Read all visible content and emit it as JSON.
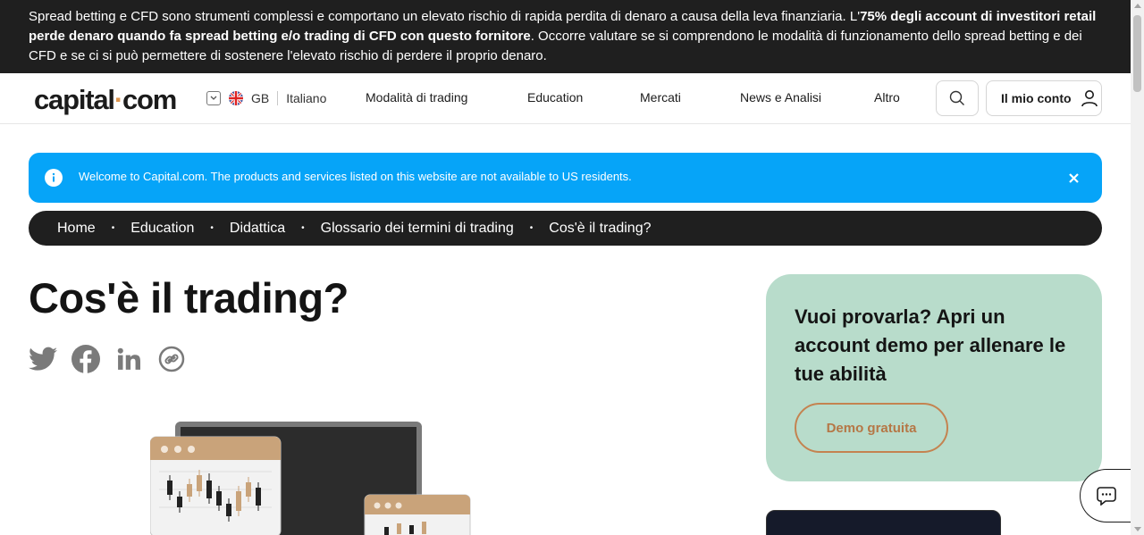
{
  "risk_warning": {
    "part1": "Spread betting e CFD sono strumenti complessi e comportano un elevato rischio di rapida perdita di denaro a causa della leva finanziaria. L'",
    "bold": "75% degli account di investitori retail perde denaro quando fa spread betting e/o trading di CFD con questo fornitore",
    "part2": ". Occorre valutare se si comprendono le modalità di funzionamento dello spread betting e dei CFD e se ci si può permettere di sostenere l'elevato rischio di perdere il proprio denaro."
  },
  "header": {
    "logo_left": "capital",
    "logo_dot": "·",
    "logo_right": "com",
    "region": "GB",
    "language": "Italiano",
    "nav": [
      "Modalità di trading",
      "Education",
      "Mercati",
      "News e Analisi",
      "Altro"
    ],
    "account_label": "Il mio conto"
  },
  "notice": {
    "message": "Welcome to Capital.com. The products and services listed on this website are not available to US residents."
  },
  "breadcrumb": [
    "Home",
    "Education",
    "Didattica",
    "Glossario dei termini di trading",
    "Cos'è il trading?"
  ],
  "breadcrumb_separator": "•",
  "page_title": "Cos'è il trading?",
  "socials": [
    "twitter-icon",
    "facebook-icon",
    "linkedin-icon",
    "copy-link-icon"
  ],
  "promo": {
    "heading": "Vuoi provarla? Apri un account demo per allenare le tue abilità",
    "button": "Demo gratuita"
  },
  "colors": {
    "accent": "#dd9650",
    "notice_bg": "#06a4f8",
    "promo_bg": "#b8dccb",
    "dark_bar": "#1f1f1f"
  }
}
